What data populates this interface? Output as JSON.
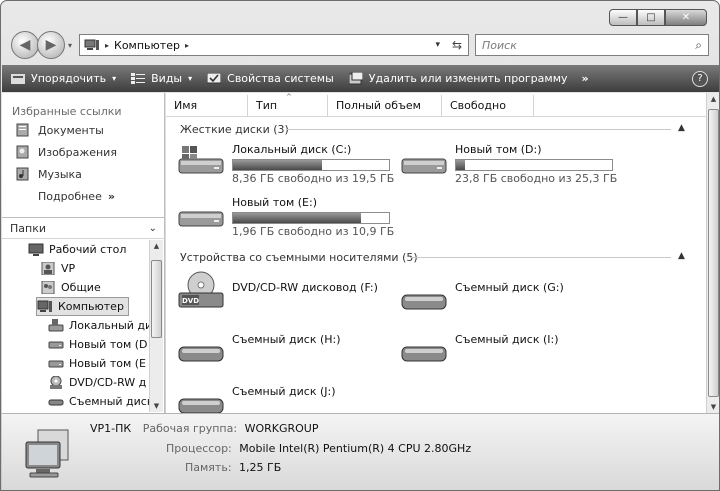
{
  "window": {
    "caption_buttons": {
      "minimize": "—",
      "maximize": "□",
      "close": "✕"
    }
  },
  "nav": {
    "back_glyph": "◀",
    "forward_glyph": "▶",
    "dropdown_glyph": "▾"
  },
  "address": {
    "path": [
      "Компьютер"
    ],
    "separator_glyph": "▸",
    "dropdown_glyph": "▾",
    "refresh_glyph": "⇆"
  },
  "search": {
    "placeholder": "Поиск",
    "icon": "magnifier-icon",
    "icon_glyph": "⌕"
  },
  "toolbar": {
    "organize": "Упорядочить",
    "views": "Виды",
    "system_properties": "Свойства системы",
    "uninstall": "Удалить или изменить программу",
    "more": "»",
    "help": "?",
    "dropdown_glyph": "▾"
  },
  "left": {
    "favorites_header": "Избранные ссылки",
    "favorites": [
      {
        "label": "Документы",
        "icon": "documents-icon"
      },
      {
        "label": "Изображения",
        "icon": "pictures-icon"
      },
      {
        "label": "Музыка",
        "icon": "music-icon"
      }
    ],
    "more": "Подробнее",
    "more_glyph": "»",
    "folders_header": "Папки",
    "folders_chevron": "⌄",
    "tree": [
      {
        "label": "Рабочий стол",
        "icon": "desktop-icon"
      },
      {
        "label": "VP",
        "icon": "user-folder-icon"
      },
      {
        "label": "Общие",
        "icon": "shared-folder-icon"
      },
      {
        "label": "Компьютер",
        "icon": "computer-icon"
      },
      {
        "label": "Локальный ди",
        "icon": "system-drive-icon"
      },
      {
        "label": "Новый том (D",
        "icon": "drive-icon"
      },
      {
        "label": "Новый том (E",
        "icon": "drive-icon"
      },
      {
        "label": "DVD/CD-RW д",
        "icon": "dvd-drive-icon"
      },
      {
        "label": "Съемный диск",
        "icon": "removable-drive-icon"
      }
    ],
    "scroll_up": "▲",
    "scroll_down": "▼"
  },
  "main": {
    "columns": [
      "Имя",
      "Тип",
      "Полный объем",
      "Свободно"
    ],
    "sort_glyph": "^",
    "groups": {
      "hard_disks": "Жесткие диски (3)",
      "removable": "Устройства со съемными носителями (5)",
      "collapse_glyph": "▲"
    },
    "hard_disks": [
      {
        "name": "Локальный диск (C:)",
        "free_text": "8,36 ГБ свободно из 19,5 ГБ",
        "used_fraction": 0.571
      },
      {
        "name": "Новый том (D:)",
        "free_text": "23,8 ГБ свободно из 25,3 ГБ",
        "used_fraction": 0.059
      },
      {
        "name": "Новый том (E:)",
        "free_text": "1,96 ГБ свободно из 10,9 ГБ",
        "used_fraction": 0.82
      }
    ],
    "removable": [
      {
        "name": "DVD/CD-RW дисковод (F:)",
        "icon": "dvd-drive-icon",
        "icon_label": "DVD"
      },
      {
        "name": "Съемный диск (G:)",
        "icon": "removable-drive-icon"
      },
      {
        "name": "Съемный диск (H:)",
        "icon": "removable-drive-icon"
      },
      {
        "name": "Съемный диск (I:)",
        "icon": "removable-drive-icon"
      },
      {
        "name": "Съемный диск (J:)",
        "icon": "removable-drive-icon"
      }
    ],
    "scroll_up": "▲",
    "scroll_down": "▼"
  },
  "details": {
    "computer_name": "VP1-ПК",
    "workgroup_label": "Рабочая группа:",
    "workgroup": "WORKGROUP",
    "cpu_label": "Процессор:",
    "cpu": "Mobile Intel(R) Pentium(R) 4 CPU 2.80GHz",
    "memory_label": "Память:",
    "memory": "1,25 ГБ"
  }
}
